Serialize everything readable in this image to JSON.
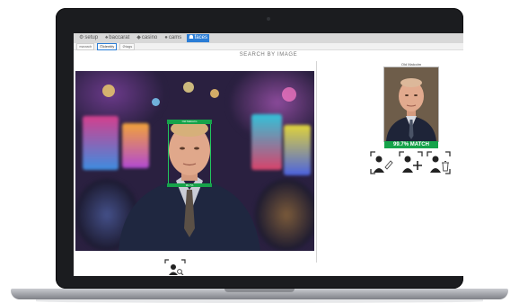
{
  "nav": {
    "items": [
      {
        "label": "setup",
        "icon": "gear-icon",
        "glyph": "⚙"
      },
      {
        "label": "baccarat",
        "icon": "cards-icon",
        "glyph": "♠"
      },
      {
        "label": "casino",
        "icon": "casino-icon",
        "glyph": "◆"
      },
      {
        "label": "cams",
        "icon": "camera-icon",
        "glyph": "●"
      },
      {
        "label": "faces",
        "icon": "faces-icon",
        "glyph": "☗"
      }
    ],
    "active": "faces"
  },
  "subtabs": [
    {
      "label": "search",
      "icon": "search-icon"
    },
    {
      "label": "identify",
      "icon": "identify-icon"
    },
    {
      "label": "tags",
      "icon": "tag-icon"
    }
  ],
  "heading": "SEARCH BY IMAGE",
  "detection": {
    "name_label": "Old Malcolm",
    "score_label": "99.7%"
  },
  "match": {
    "name": "Old Malcolm",
    "badge": "99.7% MATCH",
    "confidence": 0.997
  },
  "actions": [
    {
      "name": "edit-person-button",
      "icon": "pencil-icon"
    },
    {
      "name": "add-person-button",
      "icon": "plus-icon"
    },
    {
      "name": "delete-person-button",
      "icon": "trash-icon"
    }
  ],
  "colors": {
    "accent": "#2b7dd6",
    "match_green": "#16a34a",
    "box_green": "#22c55e",
    "laptop_bezel": "#1b1c1f"
  }
}
